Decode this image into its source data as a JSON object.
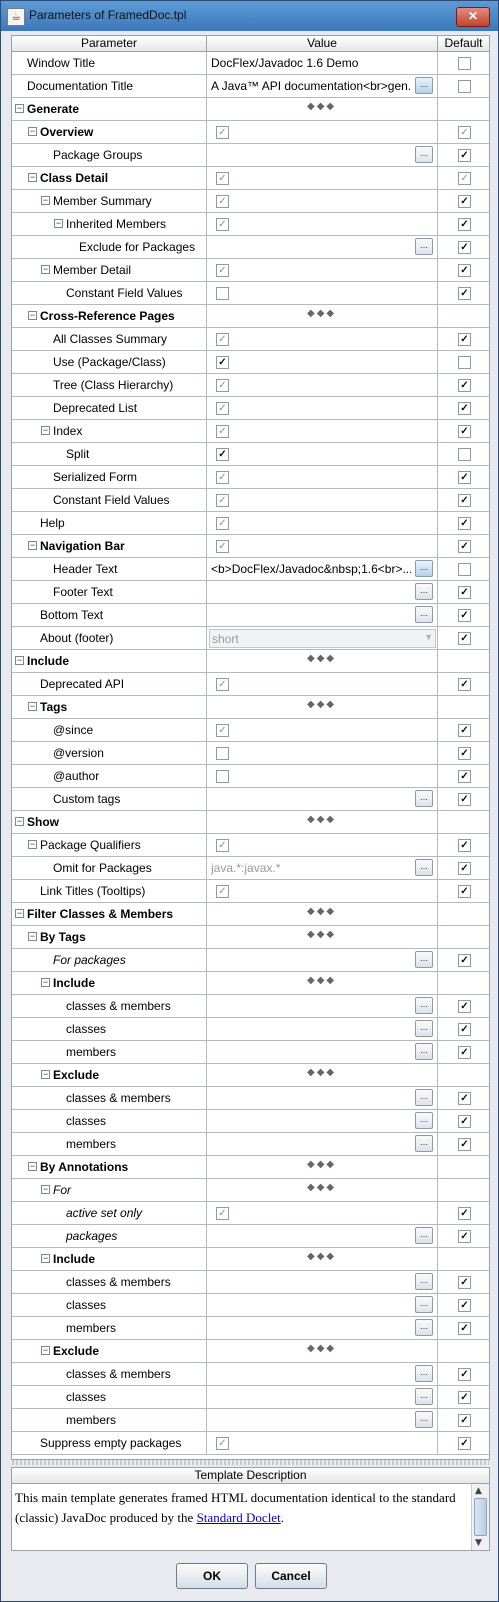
{
  "window": {
    "title": "Parameters of FramedDoc.tpl",
    "close_label": "✕"
  },
  "table": {
    "col_param": "Parameter",
    "col_value": "Value",
    "col_default": "Default"
  },
  "rows": [
    {
      "label": "Window Title",
      "indent": 0,
      "toggle": false,
      "bold": false,
      "italic": false,
      "value_type": "text",
      "value": "DocFlex/Javadoc 1.6 Demo",
      "default": false
    },
    {
      "label": "Documentation Title",
      "indent": 0,
      "toggle": false,
      "bold": false,
      "italic": false,
      "value_type": "textbtn",
      "value": "A Java™ API documentation<br>gen...",
      "default": false
    },
    {
      "label": "Generate",
      "indent": 0,
      "toggle": true,
      "bold": true,
      "italic": false,
      "value_type": "dots",
      "default": null
    },
    {
      "label": "Overview",
      "indent": 1,
      "toggle": true,
      "bold": true,
      "italic": false,
      "value_type": "check",
      "value": true,
      "default": true,
      "default_grey": true
    },
    {
      "label": "Package Groups",
      "indent": 2,
      "toggle": false,
      "bold": false,
      "italic": false,
      "value_type": "btn",
      "default": true
    },
    {
      "label": "Class Detail",
      "indent": 1,
      "toggle": true,
      "bold": true,
      "italic": false,
      "value_type": "check",
      "value": true,
      "default": true,
      "default_grey": true
    },
    {
      "label": "Member Summary",
      "indent": 2,
      "toggle": true,
      "bold": false,
      "italic": false,
      "value_type": "check",
      "value": true,
      "default": true
    },
    {
      "label": "Inherited Members",
      "indent": 3,
      "toggle": true,
      "bold": false,
      "italic": false,
      "value_type": "check",
      "value": true,
      "default": true
    },
    {
      "label": "Exclude for Packages",
      "indent": 4,
      "toggle": false,
      "bold": false,
      "italic": false,
      "value_type": "btn",
      "default": true
    },
    {
      "label": "Member Detail",
      "indent": 2,
      "toggle": true,
      "bold": false,
      "italic": false,
      "value_type": "check",
      "value": true,
      "default": true
    },
    {
      "label": "Constant Field Values",
      "indent": 3,
      "toggle": false,
      "bold": false,
      "italic": false,
      "value_type": "check",
      "value": false,
      "default": true
    },
    {
      "label": "Cross-Reference Pages",
      "indent": 1,
      "toggle": true,
      "bold": true,
      "italic": false,
      "value_type": "dots",
      "default": null
    },
    {
      "label": "All Classes Summary",
      "indent": 2,
      "toggle": false,
      "bold": false,
      "italic": false,
      "value_type": "check",
      "value": true,
      "default": true
    },
    {
      "label": "Use (Package/Class)",
      "indent": 2,
      "toggle": false,
      "bold": false,
      "italic": false,
      "value_type": "check",
      "value": true,
      "value_dark": true,
      "default": false
    },
    {
      "label": "Tree (Class Hierarchy)",
      "indent": 2,
      "toggle": false,
      "bold": false,
      "italic": false,
      "value_type": "check",
      "value": true,
      "default": true
    },
    {
      "label": "Deprecated List",
      "indent": 2,
      "toggle": false,
      "bold": false,
      "italic": false,
      "value_type": "check",
      "value": true,
      "default": true
    },
    {
      "label": "Index",
      "indent": 2,
      "toggle": true,
      "bold": false,
      "italic": false,
      "value_type": "check",
      "value": true,
      "default": true
    },
    {
      "label": "Split",
      "indent": 3,
      "toggle": false,
      "bold": false,
      "italic": false,
      "value_type": "check",
      "value": true,
      "value_dark": true,
      "default": false
    },
    {
      "label": "Serialized Form",
      "indent": 2,
      "toggle": false,
      "bold": false,
      "italic": false,
      "value_type": "check",
      "value": true,
      "default": true
    },
    {
      "label": "Constant Field Values",
      "indent": 2,
      "toggle": false,
      "bold": false,
      "italic": false,
      "value_type": "check",
      "value": true,
      "default": true
    },
    {
      "label": "Help",
      "indent": 1,
      "toggle": false,
      "bold": false,
      "italic": false,
      "value_type": "check",
      "value": true,
      "default": true
    },
    {
      "label": "Navigation Bar",
      "indent": 1,
      "toggle": true,
      "bold": true,
      "italic": false,
      "value_type": "check",
      "value": true,
      "default": true
    },
    {
      "label": "Header Text",
      "indent": 2,
      "toggle": false,
      "bold": false,
      "italic": false,
      "value_type": "textbtn",
      "value": "<b>DocFlex/Javadoc&nbsp;1.6<br>...",
      "default": false
    },
    {
      "label": "Footer Text",
      "indent": 2,
      "toggle": false,
      "bold": false,
      "italic": false,
      "value_type": "btn",
      "default": true
    },
    {
      "label": "Bottom Text",
      "indent": 1,
      "toggle": false,
      "bold": false,
      "italic": false,
      "value_type": "btn",
      "default": true
    },
    {
      "label": "About (footer)",
      "indent": 1,
      "toggle": false,
      "bold": false,
      "italic": false,
      "value_type": "combo",
      "value": "short",
      "default": true
    },
    {
      "label": "Include",
      "indent": 0,
      "toggle": true,
      "bold": true,
      "italic": false,
      "value_type": "dots",
      "default": null
    },
    {
      "label": "Deprecated API",
      "indent": 1,
      "toggle": false,
      "bold": false,
      "italic": false,
      "value_type": "check",
      "value": true,
      "default": true
    },
    {
      "label": "Tags",
      "indent": 1,
      "toggle": true,
      "bold": true,
      "italic": false,
      "value_type": "dots",
      "default": null
    },
    {
      "label": "@since",
      "indent": 2,
      "toggle": false,
      "bold": false,
      "italic": false,
      "value_type": "check",
      "value": true,
      "default": true
    },
    {
      "label": "@version",
      "indent": 2,
      "toggle": false,
      "bold": false,
      "italic": false,
      "value_type": "check",
      "value": false,
      "default": true
    },
    {
      "label": "@author",
      "indent": 2,
      "toggle": false,
      "bold": false,
      "italic": false,
      "value_type": "check",
      "value": false,
      "default": true
    },
    {
      "label": "Custom tags",
      "indent": 2,
      "toggle": false,
      "bold": false,
      "italic": false,
      "value_type": "btn",
      "default": true
    },
    {
      "label": "Show",
      "indent": 0,
      "toggle": true,
      "bold": true,
      "italic": false,
      "value_type": "dots",
      "default": null
    },
    {
      "label": "Package Qualifiers",
      "indent": 1,
      "toggle": true,
      "bold": false,
      "italic": false,
      "value_type": "check",
      "value": true,
      "default": true
    },
    {
      "label": "Omit for Packages",
      "indent": 2,
      "toggle": false,
      "bold": false,
      "italic": false,
      "value_type": "textbtn",
      "value": "java.*:javax.*",
      "value_grey": true,
      "default": true
    },
    {
      "label": "Link Titles (Tooltips)",
      "indent": 1,
      "toggle": false,
      "bold": false,
      "italic": false,
      "value_type": "check",
      "value": true,
      "default": true
    },
    {
      "label": "Filter Classes & Members",
      "indent": 0,
      "toggle": true,
      "bold": true,
      "italic": false,
      "value_type": "dots",
      "default": null
    },
    {
      "label": "By Tags",
      "indent": 1,
      "toggle": true,
      "bold": true,
      "italic": false,
      "value_type": "dots",
      "default": null
    },
    {
      "label": "For packages",
      "indent": 2,
      "toggle": false,
      "bold": false,
      "italic": true,
      "value_type": "btn",
      "default": true
    },
    {
      "label": "Include",
      "indent": 2,
      "toggle": true,
      "bold": true,
      "italic": false,
      "value_type": "dots",
      "default": null
    },
    {
      "label": "classes & members",
      "indent": 3,
      "toggle": false,
      "bold": false,
      "italic": false,
      "value_type": "btn",
      "default": true
    },
    {
      "label": "classes",
      "indent": 3,
      "toggle": false,
      "bold": false,
      "italic": false,
      "value_type": "btn",
      "default": true
    },
    {
      "label": "members",
      "indent": 3,
      "toggle": false,
      "bold": false,
      "italic": false,
      "value_type": "btn",
      "default": true
    },
    {
      "label": "Exclude",
      "indent": 2,
      "toggle": true,
      "bold": true,
      "italic": false,
      "value_type": "dots",
      "default": null
    },
    {
      "label": "classes & members",
      "indent": 3,
      "toggle": false,
      "bold": false,
      "italic": false,
      "value_type": "btn",
      "default": true
    },
    {
      "label": "classes",
      "indent": 3,
      "toggle": false,
      "bold": false,
      "italic": false,
      "value_type": "btn",
      "default": true
    },
    {
      "label": "members",
      "indent": 3,
      "toggle": false,
      "bold": false,
      "italic": false,
      "value_type": "btn",
      "default": true
    },
    {
      "label": "By Annotations",
      "indent": 1,
      "toggle": true,
      "bold": true,
      "italic": false,
      "value_type": "dots",
      "default": null
    },
    {
      "label": "For",
      "indent": 2,
      "toggle": true,
      "bold": false,
      "italic": true,
      "value_type": "dots",
      "default": null
    },
    {
      "label": "active set only",
      "indent": 3,
      "toggle": false,
      "bold": false,
      "italic": true,
      "value_type": "check",
      "value": true,
      "default": true
    },
    {
      "label": "packages",
      "indent": 3,
      "toggle": false,
      "bold": false,
      "italic": true,
      "value_type": "btn",
      "default": true
    },
    {
      "label": "Include",
      "indent": 2,
      "toggle": true,
      "bold": true,
      "italic": false,
      "value_type": "dots",
      "default": null
    },
    {
      "label": "classes & members",
      "indent": 3,
      "toggle": false,
      "bold": false,
      "italic": false,
      "value_type": "btn",
      "default": true
    },
    {
      "label": "classes",
      "indent": 3,
      "toggle": false,
      "bold": false,
      "italic": false,
      "value_type": "btn",
      "default": true
    },
    {
      "label": "members",
      "indent": 3,
      "toggle": false,
      "bold": false,
      "italic": false,
      "value_type": "btn",
      "default": true
    },
    {
      "label": "Exclude",
      "indent": 2,
      "toggle": true,
      "bold": true,
      "italic": false,
      "value_type": "dots",
      "default": null
    },
    {
      "label": "classes & members",
      "indent": 3,
      "toggle": false,
      "bold": false,
      "italic": false,
      "value_type": "btn",
      "default": true
    },
    {
      "label": "classes",
      "indent": 3,
      "toggle": false,
      "bold": false,
      "italic": false,
      "value_type": "btn",
      "default": true
    },
    {
      "label": "members",
      "indent": 3,
      "toggle": false,
      "bold": false,
      "italic": false,
      "value_type": "btn",
      "default": true
    },
    {
      "label": "Suppress empty packages",
      "indent": 1,
      "toggle": false,
      "bold": false,
      "italic": false,
      "value_type": "check",
      "value": true,
      "default": true
    }
  ],
  "description": {
    "header": "Template Description",
    "text_before_link": "This main template generates framed HTML documentation identical to the standard (classic) JavaDoc produced by the ",
    "link_text": "Standard Doclet",
    "text_after_link": "."
  },
  "buttons": {
    "ok": "OK",
    "cancel": "Cancel"
  },
  "icons": {
    "app": "java-cup-icon",
    "close": "close-icon",
    "expand": "collapse-minus-icon",
    "check": "checkbox-icon",
    "more": "ellipsis-button-icon",
    "combo": "chevron-down-icon"
  }
}
